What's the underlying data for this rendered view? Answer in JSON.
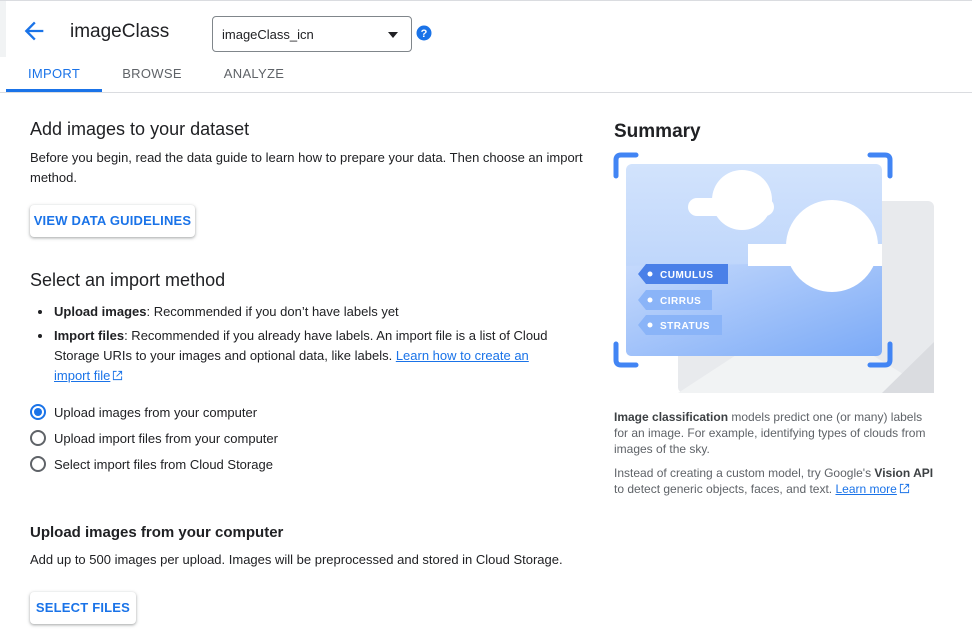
{
  "header": {
    "title": "imageClass",
    "dataset_select": {
      "value": "imageClass_icn"
    }
  },
  "tabs": [
    {
      "label": "IMPORT",
      "active": true
    },
    {
      "label": "BROWSE",
      "active": false
    },
    {
      "label": "ANALYZE",
      "active": false
    }
  ],
  "main": {
    "add_images": {
      "title": "Add images to your dataset",
      "description": "Before you begin, read the data guide to learn how to prepare your data. Then choose an import method.",
      "guidelines_button": "VIEW DATA GUIDELINES"
    },
    "import_method": {
      "title": "Select an import method",
      "bullets": [
        {
          "bold": "Upload images",
          "text": ": Recommended if you don’t have labels yet"
        },
        {
          "bold": "Import files",
          "text": ": Recommended if you already have labels. An import file is a list of Cloud Storage URIs to your images and optional data, like labels. ",
          "link": "Learn how to create an import file"
        }
      ],
      "options": [
        {
          "label": "Upload images from your computer",
          "checked": true
        },
        {
          "label": "Upload import files from your computer",
          "checked": false
        },
        {
          "label": "Select import files from Cloud Storage",
          "checked": false
        }
      ]
    },
    "upload_section": {
      "title": "Upload images from your computer",
      "description": "Add up to 500 images per upload. Images will be preprocessed and stored in Cloud Storage.",
      "select_button": "SELECT FILES"
    }
  },
  "summary": {
    "title": "Summary",
    "illustration_labels": [
      "CUMULUS",
      "CIRRUS",
      "STRATUS"
    ],
    "para1_bold": "Image classification",
    "para1_text": " models predict one (or many) labels for an image. For example, identifying types of clouds from images of the sky.",
    "para2_text": "Instead of creating a custom model, try Google's ",
    "para2_bold": "Vision API",
    "para2_text2": " to detect generic objects, faces, and text. ",
    "para2_link": "Learn more"
  },
  "colors": {
    "accent": "#1a73e8",
    "tag": "#4a80e8",
    "sky": "#c6dafc"
  }
}
